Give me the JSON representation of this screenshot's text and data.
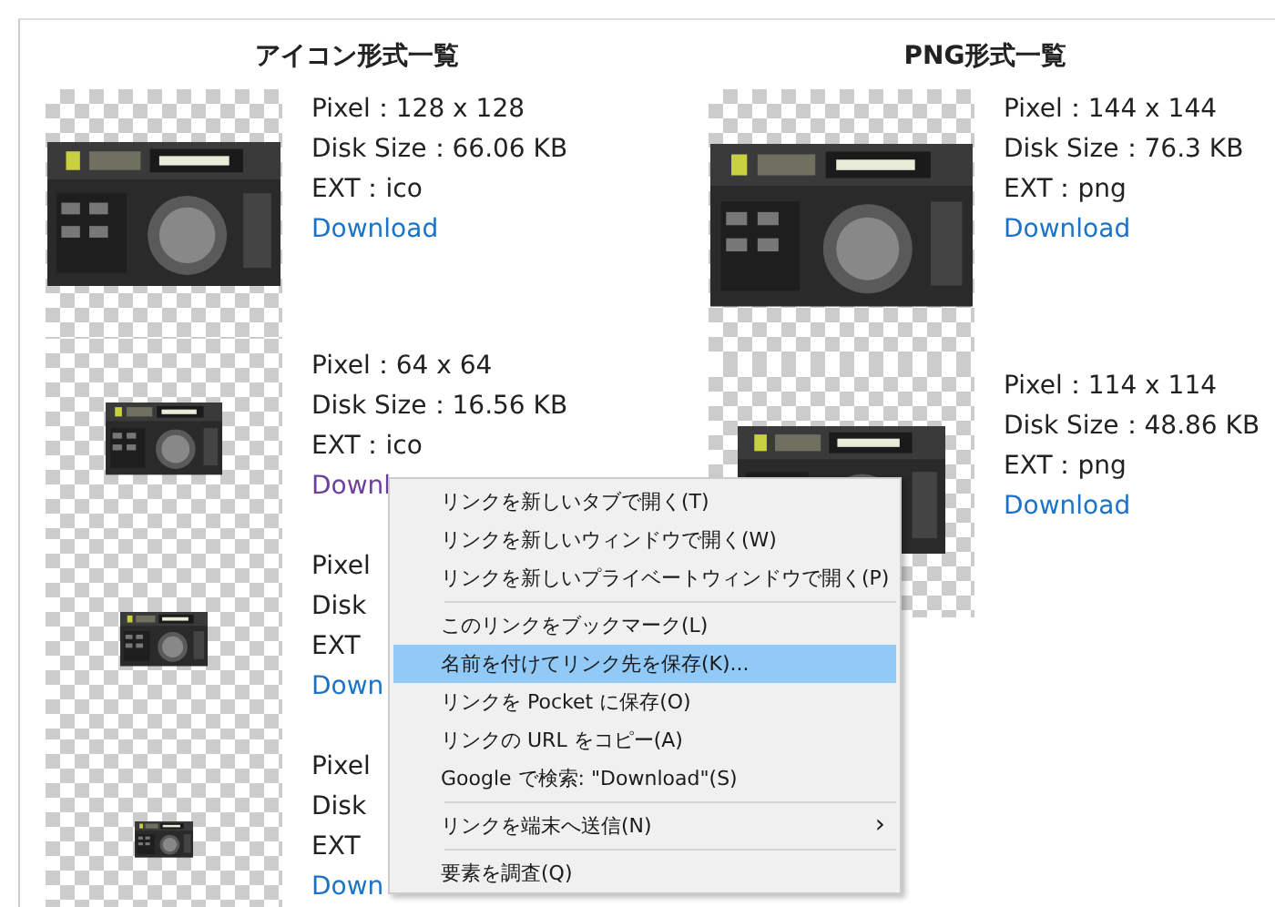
{
  "columns": [
    {
      "title": "アイコン形式一覧",
      "entries": [
        {
          "pixel": "Pixel：128 x 128",
          "size": "Disk Size：66.06 KB",
          "ext": "EXT：ico",
          "link": {
            "label": "Download",
            "visited": false
          }
        },
        {
          "pixel": "Pixel：64 x 64",
          "size": "Disk Size：16.56 KB",
          "ext": "EXT：ico",
          "link": {
            "label": "Downl",
            "visited": true
          }
        },
        {
          "pixel": "Pixel",
          "size": "Disk",
          "ext": "EXT",
          "link": {
            "label": "Down",
            "visited": false
          }
        },
        {
          "pixel": "Pixel",
          "size": "Disk",
          "ext": "EXT",
          "link": {
            "label": "Down",
            "visited": false
          }
        }
      ]
    },
    {
      "title": "PNG形式一覧",
      "entries": [
        {
          "pixel": "Pixel：144 x 144",
          "size": "Disk Size：76.3 KB",
          "ext": "EXT：png",
          "link": {
            "label": "Download",
            "visited": false
          }
        },
        {
          "pixel": "Pixel：114 x 114",
          "size": "Disk Size：48.86 KB",
          "ext": "EXT：png",
          "link": {
            "label": "Download",
            "visited": false
          }
        }
      ]
    }
  ],
  "context_menu": {
    "items": [
      {
        "kind": "item",
        "label": "リンクを新しいタブで開く(T)",
        "selected": false
      },
      {
        "kind": "item",
        "label": "リンクを新しいウィンドウで開く(W)",
        "selected": false
      },
      {
        "kind": "item",
        "label": "リンクを新しいプライベートウィンドウで開く(P)",
        "selected": false
      },
      {
        "kind": "separator"
      },
      {
        "kind": "item",
        "label": "このリンクをブックマーク(L)",
        "selected": false
      },
      {
        "kind": "item",
        "label": "名前を付けてリンク先を保存(K)...",
        "selected": true
      },
      {
        "kind": "item",
        "label": "リンクを Pocket に保存(O)",
        "selected": false
      },
      {
        "kind": "item",
        "label": "リンクの URL をコピー(A)",
        "selected": false
      },
      {
        "kind": "item",
        "label": "Google で検索: \"Download\"(S)",
        "selected": false
      },
      {
        "kind": "separator"
      },
      {
        "kind": "submenu",
        "label": "リンクを端末へ送信(N)",
        "arrow": "›",
        "selected": false
      },
      {
        "kind": "separator"
      },
      {
        "kind": "item",
        "label": "要素を調査(Q)",
        "selected": false
      }
    ]
  }
}
